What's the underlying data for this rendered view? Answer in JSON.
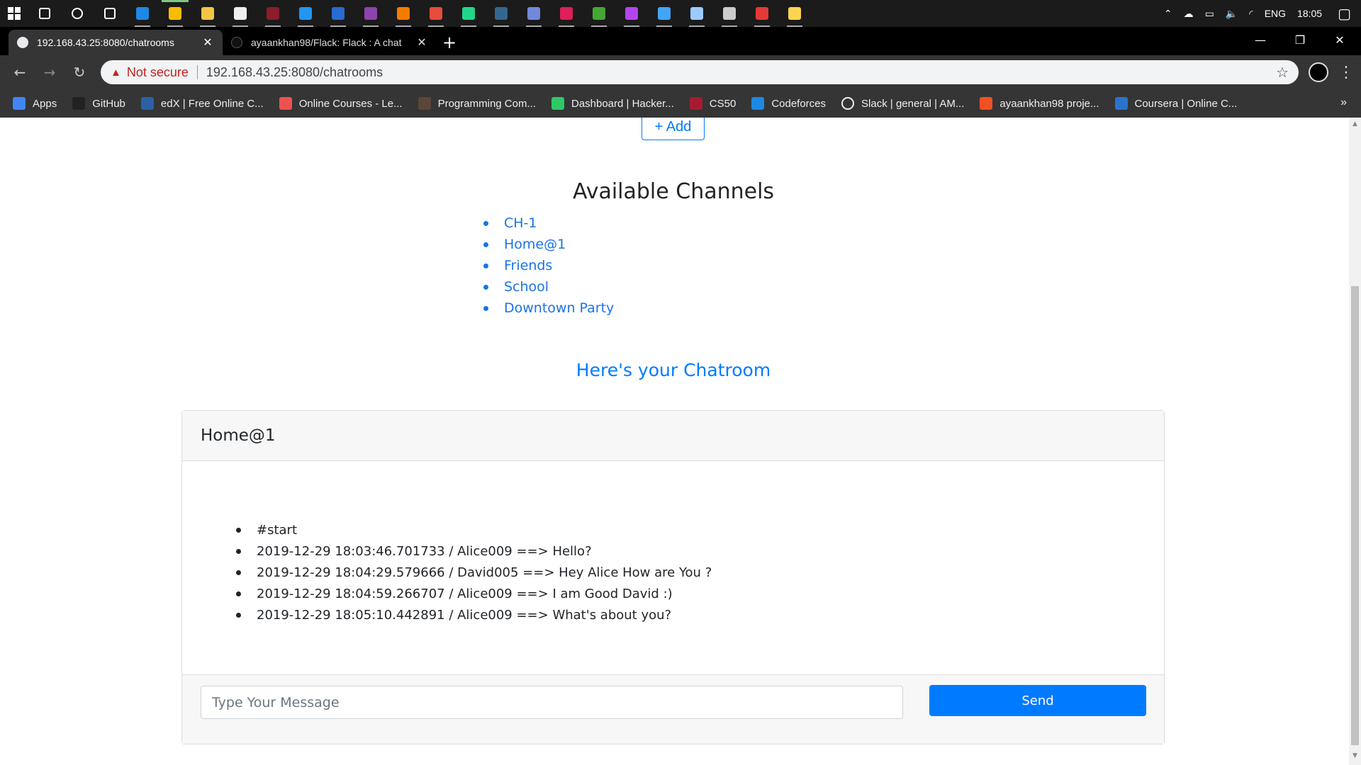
{
  "taskbar": {
    "apps": [
      {
        "name": "search-icon",
        "color": "#ffffff"
      },
      {
        "name": "cortana-icon",
        "color": "#ffffff"
      },
      {
        "name": "task-view-icon",
        "color": "#ffffff"
      },
      {
        "name": "edge-icon",
        "color": "#1e88e5"
      },
      {
        "name": "chrome-icon",
        "color": "#fbbc04"
      },
      {
        "name": "file-explorer-icon",
        "color": "#f4c542"
      },
      {
        "name": "git-icon",
        "color": "#f0f0f0"
      },
      {
        "name": "app-icon",
        "color": "#8b1e2b"
      },
      {
        "name": "vscode-icon",
        "color": "#2196f3"
      },
      {
        "name": "powershell-icon",
        "color": "#2a6bd1"
      },
      {
        "name": "visual-studio-icon",
        "color": "#8e44ad"
      },
      {
        "name": "jupyter-icon",
        "color": "#f57c00"
      },
      {
        "name": "office-icon",
        "color": "#e74c3c"
      },
      {
        "name": "pycharm-icon",
        "color": "#21d789"
      },
      {
        "name": "postgres-icon",
        "color": "#336791"
      },
      {
        "name": "discord-icon",
        "color": "#7289da"
      },
      {
        "name": "slack-icon",
        "color": "#e01e5a"
      },
      {
        "name": "anaconda-icon",
        "color": "#44a833"
      },
      {
        "name": "phpstorm-icon",
        "color": "#b345f1"
      },
      {
        "name": "remote-desktop-icon",
        "color": "#42a5f5"
      },
      {
        "name": "virtualbox-icon",
        "color": "#9ecbff"
      },
      {
        "name": "terminal-icon",
        "color": "#cccccc"
      },
      {
        "name": "acrobat-icon",
        "color": "#e53935"
      },
      {
        "name": "sourcetree-icon",
        "color": "#ffd54f"
      }
    ],
    "tray": {
      "language": "ENG",
      "time": "18:05"
    }
  },
  "browser": {
    "tabs": [
      {
        "title": "192.168.43.25:8080/chatrooms",
        "close": "✕"
      },
      {
        "title": "ayaankhan98/Flack: Flack : A chat",
        "close": "✕"
      }
    ],
    "new_tab": "+",
    "address": {
      "warning": "Not secure",
      "url": "192.168.43.25:8080/chatrooms"
    },
    "bookmarks": [
      {
        "label": "Apps",
        "icon": "apps-grid-icon",
        "color": "#4285f4"
      },
      {
        "label": "GitHub",
        "icon": "github-icon",
        "color": "#222222"
      },
      {
        "label": "edX | Free Online C...",
        "icon": "edx-icon",
        "color": "#2e5fa7"
      },
      {
        "label": "Online Courses - Le...",
        "icon": "udemy-icon",
        "color": "#ec5252"
      },
      {
        "label": "Programming Com...",
        "icon": "codechef-icon",
        "color": "#5b4638"
      },
      {
        "label": "Dashboard | Hacker...",
        "icon": "hackerrank-icon",
        "color": "#2ec866"
      },
      {
        "label": "CS50",
        "icon": "cs50-icon",
        "color": "#a51c30"
      },
      {
        "label": "Codeforces",
        "icon": "codeforces-icon",
        "color": "#1e88e5"
      },
      {
        "label": "Slack | general | AM...",
        "icon": "globe-icon",
        "color": "#eeeeee"
      },
      {
        "label": "ayaankhan98 proje...",
        "icon": "microsoft-icon",
        "color": "#f25022"
      },
      {
        "label": "Coursera | Online C...",
        "icon": "coursera-icon",
        "color": "#2a73cc"
      }
    ],
    "more": "»"
  },
  "page": {
    "add_button": "+ Add",
    "channels_heading": "Available Channels",
    "channels": [
      "CH-1",
      "Home@1",
      "Friends",
      "School",
      "Downtown Party"
    ],
    "chatroom_heading": "Here's your Chatroom",
    "chatroom": {
      "name": "Home@1",
      "messages": [
        "#start",
        "2019-12-29 18:03:46.701733 / Alice009 ==> Hello?",
        "2019-12-29 18:04:29.579666 / David005 ==> Hey Alice How are You ?",
        "2019-12-29 18:04:59.266707 / Alice009 ==> I am Good David :)",
        "2019-12-29 18:05:10.442891 / Alice009 ==> What's about you?"
      ],
      "input_placeholder": "Type Your Message",
      "send_label": "Send"
    }
  }
}
